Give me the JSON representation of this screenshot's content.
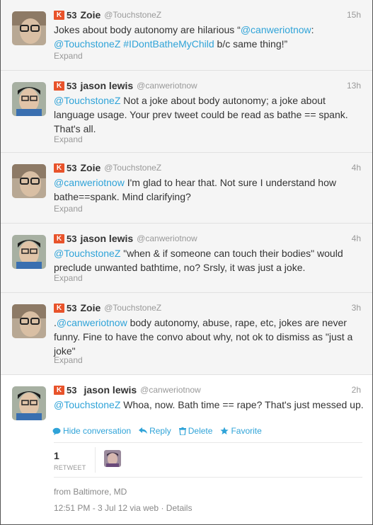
{
  "tweets": [
    {
      "klout": "53",
      "name": "Zoie",
      "handle": "@TouchstoneZ",
      "time": "15h",
      "text_parts": [
        "Jokes about body autonomy are hilarious “",
        "@canweriotnow",
        ":\n",
        "@TouchstoneZ",
        " ",
        "#IDontBatheMyChild",
        " b/c same thing!”"
      ],
      "expand": "Expand"
    },
    {
      "klout": "53",
      "name": "jason lewis",
      "handle": "@canweriotnow",
      "time": "13h",
      "text_parts": [
        "@TouchstoneZ",
        " Not a joke about body autonomy; a joke about language usage. Your prev tweet could be read as bathe == spank. That's all."
      ],
      "expand": "Expand"
    },
    {
      "klout": "53",
      "name": "Zoie",
      "handle": "@TouchstoneZ",
      "time": "4h",
      "text_parts": [
        "@canweriotnow",
        " I'm glad to hear that. Not sure I understand how bathe==spank. Mind clarifying?"
      ],
      "expand": "Expand"
    },
    {
      "klout": "53",
      "name": "jason lewis",
      "handle": "@canweriotnow",
      "time": "4h",
      "text_parts": [
        "@TouchstoneZ",
        " \"when & if someone can touch their bodies\" would preclude unwanted bathtime, no? Srsly, it was just a joke."
      ],
      "expand": "Expand"
    },
    {
      "klout": "53",
      "name": "Zoie",
      "handle": "@TouchstoneZ",
      "time": "3h",
      "text_parts": [
        ".",
        "@canweriotnow",
        " body autonomy, abuse, rape, etc, jokes are never funny. Fine to have the convo about why, not ok to dismiss as \"just a joke\""
      ],
      "expand": "Expand"
    }
  ],
  "focused": {
    "klout": "53",
    "name": "jason lewis",
    "handle": "@canweriotnow",
    "time": "2h",
    "text_parts": [
      "@TouchstoneZ",
      " Whoa, now. Bath time == rape? That's just messed up."
    ],
    "actions": {
      "hide": "Hide conversation",
      "reply": "Reply",
      "delete": "Delete",
      "favorite": "Favorite"
    },
    "retweet_count": "1",
    "retweet_label": "RETWEET",
    "location": "from Baltimore, MD",
    "timestamp": "12:51 PM - 3 Jul 12",
    "via": "via web",
    "dot": "·",
    "details": "Details"
  },
  "colors": {
    "link": "#2fa3d8",
    "klout": "#e8532b",
    "muted": "#999999"
  },
  "icons": [
    "klout-icon",
    "conversation-icon",
    "reply-icon",
    "delete-icon",
    "favorite-icon"
  ]
}
